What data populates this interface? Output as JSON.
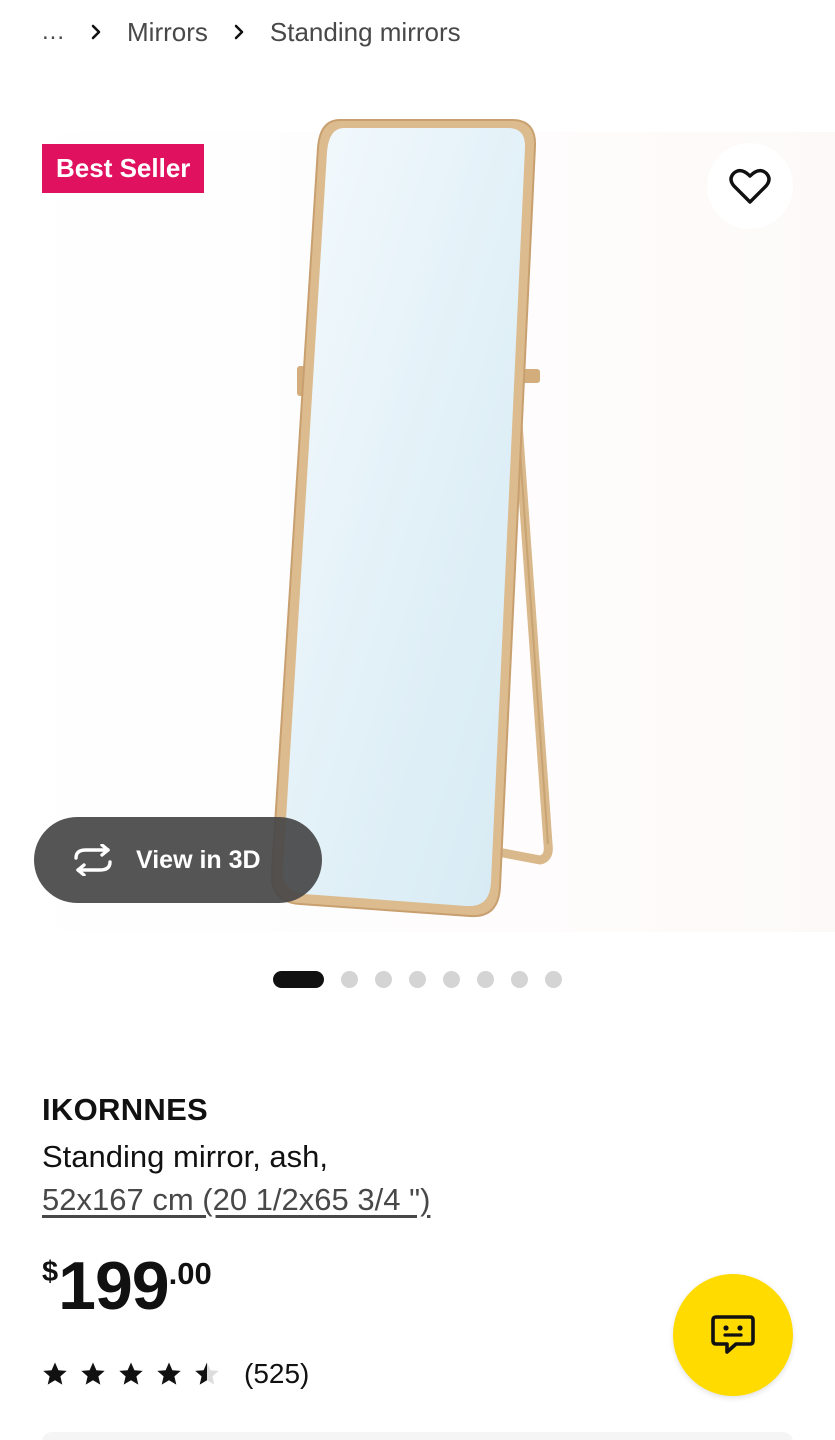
{
  "breadcrumb": {
    "ellipsis": "...",
    "items": [
      {
        "label": "Mirrors"
      },
      {
        "label": "Standing mirrors"
      }
    ]
  },
  "gallery": {
    "badge": "Best Seller",
    "view_3d_label": "View in 3D",
    "dots_total": 8,
    "active_dot": 0,
    "favorite_icon": "heart-outline-icon"
  },
  "product": {
    "name": "IKORNNES",
    "description": "Standing mirror, ash,",
    "size": "52x167 cm (20 1/2x65 3/4 \")"
  },
  "price": {
    "currency": "$",
    "whole": "199",
    "decimal": ".00"
  },
  "rating": {
    "stars": 4.5,
    "max": 5,
    "count": "(525)"
  },
  "chat": {
    "icon": "chat-bubble-icon"
  },
  "colors": {
    "badge": "#e0115f",
    "chat_button": "#ffdb00",
    "view3d_pill": "#484848",
    "dot_active": "#111111",
    "dot_inactive": "#d4d4d4",
    "frame_wood": "#d9b88b",
    "glass": "#dfeff6"
  }
}
